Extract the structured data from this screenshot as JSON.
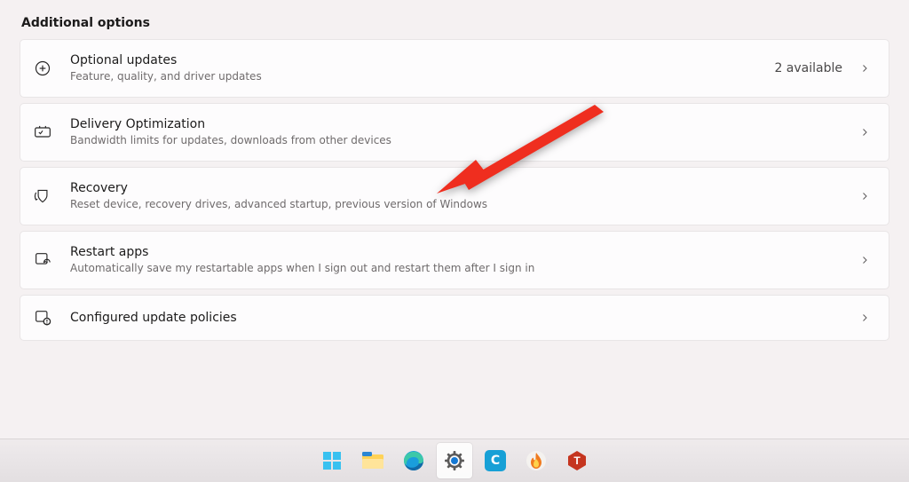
{
  "section_title": "Additional options",
  "items": [
    {
      "icon": "plus-circle-icon",
      "title": "Optional updates",
      "subtitle": "Feature, quality, and driver updates",
      "trailing_text": "2 available",
      "chevron": true
    },
    {
      "icon": "delivery-optimization-icon",
      "title": "Delivery Optimization",
      "subtitle": "Bandwidth limits for updates, downloads from other devices",
      "trailing_text": "",
      "chevron": true
    },
    {
      "icon": "recovery-icon",
      "title": "Recovery",
      "subtitle": "Reset device, recovery drives, advanced startup, previous version of Windows",
      "trailing_text": "",
      "chevron": true
    },
    {
      "icon": "restart-apps-icon",
      "title": "Restart apps",
      "subtitle": "Automatically save my restartable apps when I sign out and restart them after I sign in",
      "trailing_text": "",
      "chevron": true
    },
    {
      "icon": "configured-update-policies-icon",
      "title": "Configured update policies",
      "subtitle": "",
      "trailing_text": "",
      "chevron": true
    }
  ],
  "annotation": {
    "type": "arrow",
    "color": "#ef2e1f",
    "points_to": "Recovery"
  },
  "taskbar": {
    "items": [
      {
        "name": "start-button",
        "label": "Start"
      },
      {
        "name": "file-explorer-icon",
        "label": "File Explorer"
      },
      {
        "name": "edge-browser-icon",
        "label": "Microsoft Edge"
      },
      {
        "name": "settings-icon",
        "label": "Settings",
        "active": true
      },
      {
        "name": "app-c-icon",
        "label": "C"
      },
      {
        "name": "app-flame-icon",
        "label": "Flame app"
      },
      {
        "name": "app-t-icon",
        "label": "T"
      }
    ]
  }
}
